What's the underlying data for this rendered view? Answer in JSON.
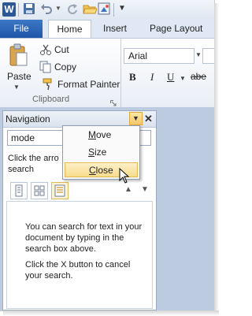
{
  "app": {
    "logo_letter": "W"
  },
  "quick_access": {
    "save": "save-icon",
    "undo": "undo-icon",
    "redo": "redo-icon",
    "open": "open-icon",
    "customize": "customize-icon",
    "more": "▼"
  },
  "tabs": [
    {
      "label": "File"
    },
    {
      "label": "Home"
    },
    {
      "label": "Insert"
    },
    {
      "label": "Page Layout"
    }
  ],
  "clipboard": {
    "paste_label": "Paste",
    "cut_label": "Cut",
    "copy_label": "Copy",
    "format_painter_label": "Format Painter",
    "group_label": "Clipboard"
  },
  "font": {
    "family": "Arial",
    "bold": "B",
    "italic": "I",
    "underline": "U",
    "strike": "abe"
  },
  "navigation": {
    "title": "Navigation",
    "search_value": "mode",
    "hint_line1": "Click the arro",
    "hint_line2": "search",
    "message1": "You can search for text in your document by typing in the search box above.",
    "message2": "Click the X button to cancel your search."
  },
  "menu": {
    "items": [
      {
        "first": "M",
        "rest": "ove"
      },
      {
        "first": "S",
        "rest": "ize"
      },
      {
        "first": "C",
        "rest": "lose"
      }
    ],
    "highlighted": "Close"
  },
  "colors": {
    "file_tab": "#1f56a6",
    "highlight": "#f8dc8d",
    "doc_background": "#bccbdf"
  }
}
